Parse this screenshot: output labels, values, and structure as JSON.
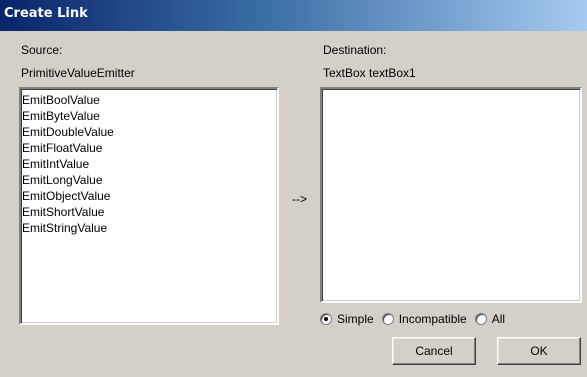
{
  "window": {
    "title": "Create Link"
  },
  "source": {
    "label": "Source:",
    "name": "PrimitiveValueEmitter",
    "items": [
      "EmitBoolValue",
      "EmitByteValue",
      "EmitDoubleValue",
      "EmitFloatValue",
      "EmitIntValue",
      "EmitLongValue",
      "EmitObjectValue",
      "EmitShortValue",
      "EmitStringValue"
    ]
  },
  "arrow": "-->",
  "destination": {
    "label": "Destination:",
    "name": "TextBox textBox1",
    "items": []
  },
  "filter": {
    "options": [
      "Simple",
      "Incompatible",
      "All"
    ],
    "selected": "Simple"
  },
  "buttons": {
    "cancel": "Cancel",
    "ok": "OK"
  }
}
